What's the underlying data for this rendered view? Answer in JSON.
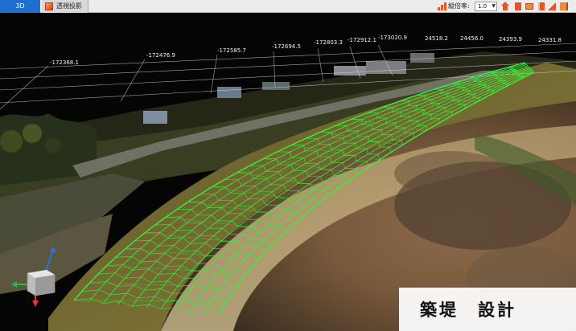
{
  "tabs": [
    {
      "label": "3D",
      "active": true
    },
    {
      "label": "透視投影",
      "active": false
    }
  ],
  "toolbar": {
    "ratio_label": "縦倍率:",
    "ratio_value": "1.0",
    "buttons": [
      "ratio-chart-icon",
      "home-icon",
      "view-front-icon",
      "view-box-icon",
      "view-side-icon",
      "view-diagonal-icon",
      "view-back-icon"
    ]
  },
  "grid_labels": {
    "x_values": [
      "-172368.1",
      "-172476.9",
      "-172585.7",
      "-172694.5",
      "-172803.3",
      "-172912.1",
      "-173020.9"
    ],
    "y_values": [
      "24518.2",
      "24456.0",
      "24393.9",
      "24331.8"
    ]
  },
  "caption": "築堤　設計",
  "colors": {
    "tab_active": "#1e6fd0",
    "wireframe": "#38f038",
    "axis_x": "#e03b2b",
    "axis_y": "#2bb54a",
    "axis_z": "#2b6fe0"
  }
}
